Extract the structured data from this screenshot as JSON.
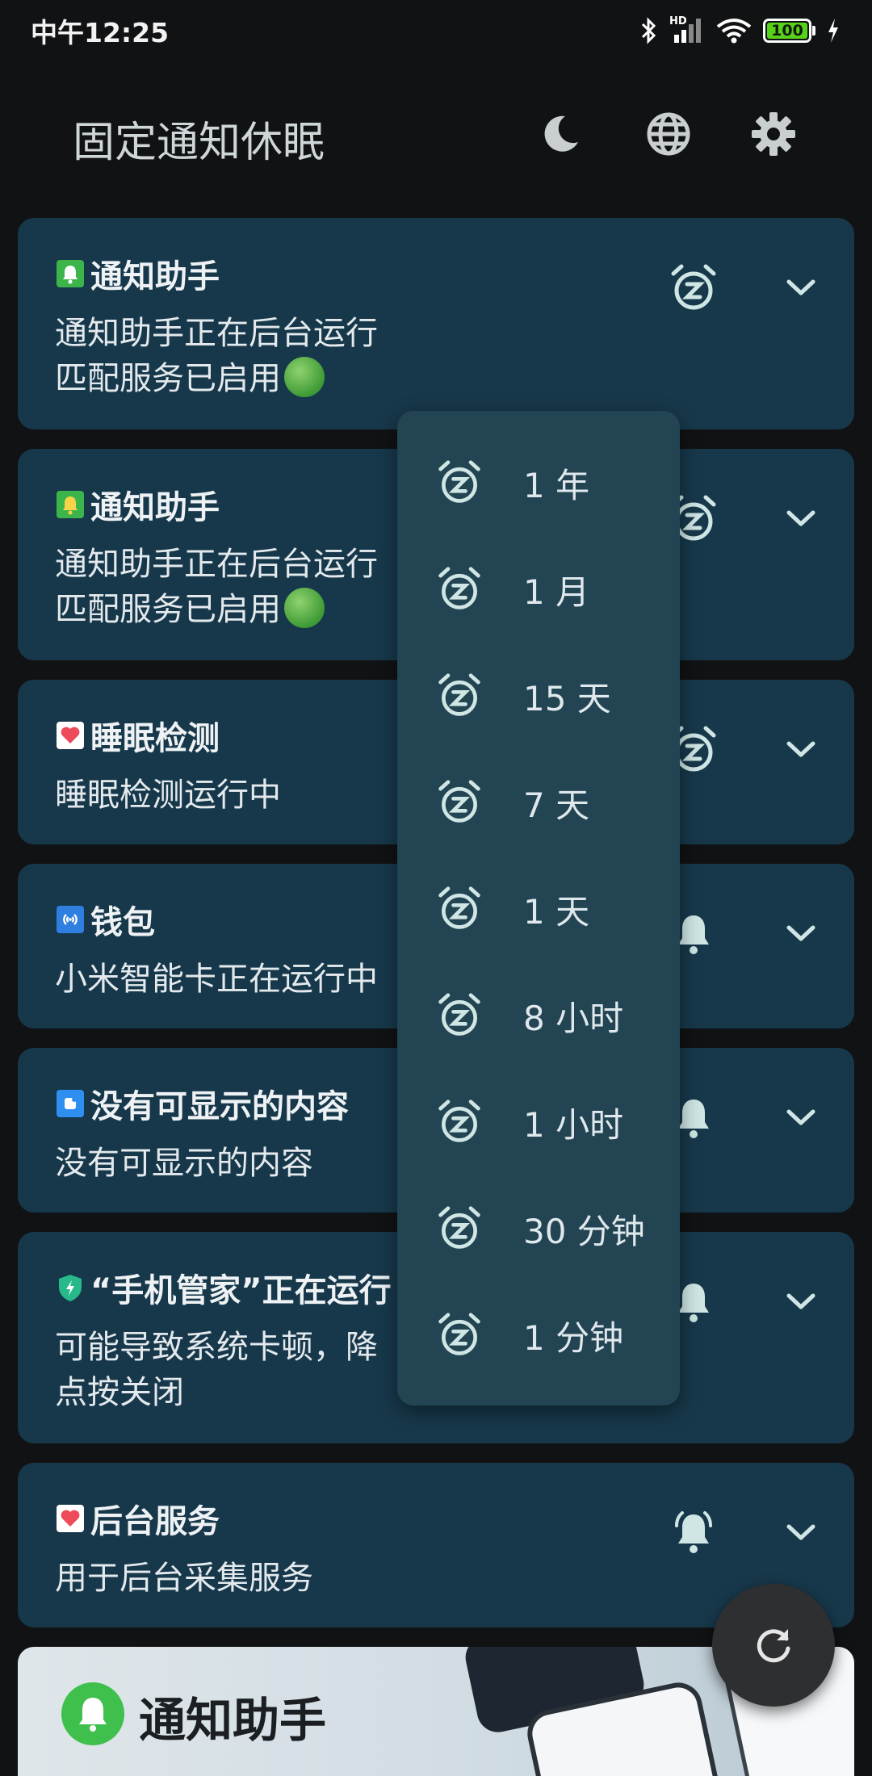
{
  "status_bar": {
    "time": "中午12:25",
    "battery": "100",
    "network_label": "HD"
  },
  "app_bar": {
    "title": "固定通知休眠",
    "actions": [
      "dark-mode-icon",
      "language-icon",
      "settings-icon"
    ]
  },
  "cards": [
    {
      "app_name": "通知助手",
      "icon_color": "#3bb54a",
      "lines": [
        "通知助手正在后台运行",
        "匹配服务已启用"
      ],
      "has_green_dot": true,
      "action_icon": "snooze-icon"
    },
    {
      "app_name": "通知助手",
      "icon_color": "#3bb54a",
      "lines": [
        "通知助手正在后台运行",
        "匹配服务已启用"
      ],
      "has_green_dot": true,
      "action_icon": "snooze-icon"
    },
    {
      "app_name": "睡眠检测",
      "icon_color": "#ffffff",
      "lines": [
        "睡眠检测运行中"
      ],
      "action_icon": "snooze-icon"
    },
    {
      "app_name": "钱包",
      "icon_color": "#2f7fe0",
      "lines": [
        "小米智能卡正在运行中"
      ],
      "action_icon": "bell-icon"
    },
    {
      "app_name": "没有可显示的内容",
      "icon_color": "#2f8ff0",
      "lines": [
        "没有可显示的内容"
      ],
      "action_icon": "bell-icon"
    },
    {
      "app_name": "“手机管家”正在运行",
      "icon_color": "#27b98a",
      "lines": [
        "可能导致系统卡顿，降",
        "点按关闭"
      ],
      "action_icon": "bell-icon"
    },
    {
      "app_name": "后台服务",
      "icon_color": "#ffffff",
      "lines": [
        "用于后台采集服务"
      ],
      "action_icon": "bell-icon"
    }
  ],
  "snooze_menu": {
    "items": [
      "1 年",
      "1 月",
      "15 天",
      "7 天",
      "1 天",
      "8 小时",
      "1 小时",
      "30 分钟",
      "1 分钟"
    ]
  },
  "promo": {
    "title": "通知助手"
  },
  "fab": {
    "icon": "refresh-icon"
  },
  "colors": {
    "background": "#111213",
    "card": "#17384b",
    "menu": "#234452",
    "icon_tint": "#cfe6e4"
  }
}
